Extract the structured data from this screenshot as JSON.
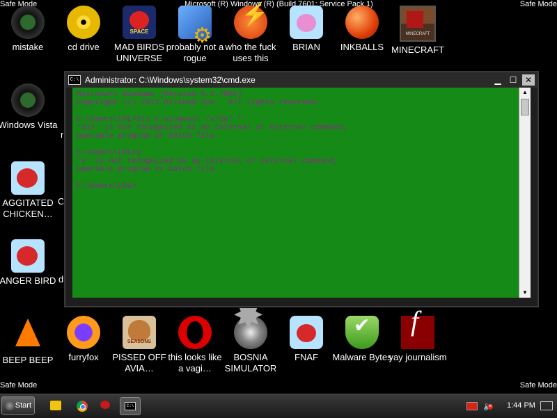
{
  "safe_mode": "Safe Mode",
  "build_text": "Microsoft (R) Windows (R) (Build 7601: Service Pack 1)",
  "desktop_icons": [
    {
      "label": "mistake"
    },
    {
      "label": "cd drive"
    },
    {
      "label": "MAD BIRDS UNIVERSE"
    },
    {
      "label": "probably not a rogue"
    },
    {
      "label": "who the fuck uses this"
    },
    {
      "label": "BRIAN"
    },
    {
      "label": "INKBALLS"
    },
    {
      "label": "MINECRAFT"
    },
    {
      "label": "Windows Vista"
    },
    {
      "label": "AGGITATED CHICKEN…"
    },
    {
      "label": "ANGER BIRD"
    },
    {
      "label": "BEEP BEEP"
    },
    {
      "label": "furryfox"
    },
    {
      "label": "PISSED OFF AVIA…"
    },
    {
      "label": "this looks like a vagi…"
    },
    {
      "label": "BOSNIA SIMULATOR"
    },
    {
      "label": "FNAF"
    },
    {
      "label": "Malware Bytes"
    },
    {
      "label": "yay journalism"
    }
  ],
  "cut_labels": {
    "c": "C",
    "d": "d",
    "r": "r"
  },
  "cmd": {
    "title": "Administrator: C:\\Windows\\system32\\cmd.exe",
    "icon_text": "C:\\",
    "lines": [
      "Microsoft Windows [Version 6.1.7601]",
      "Copyright (c) 2012 Dilshad Sys.  All rights reserved.",
      "",
      "C:\\Users\\LOL>dis C:windows\\ /s/del *",
      "'dis' is not recognized as an internal or external command,",
      "operable program or batch file.",
      "",
      "C:\\Users\\LOL>y",
      "'y' is not recognized as an internal or external command,",
      "operable program or batch file.",
      "",
      "C:\\Users\\LOL>"
    ],
    "cursor": "_"
  },
  "taskbar": {
    "start_label": "Start",
    "clock": "1:44 PM"
  },
  "colors": {
    "console_bg": "#168a16",
    "console_text": "#8a2a8a"
  }
}
